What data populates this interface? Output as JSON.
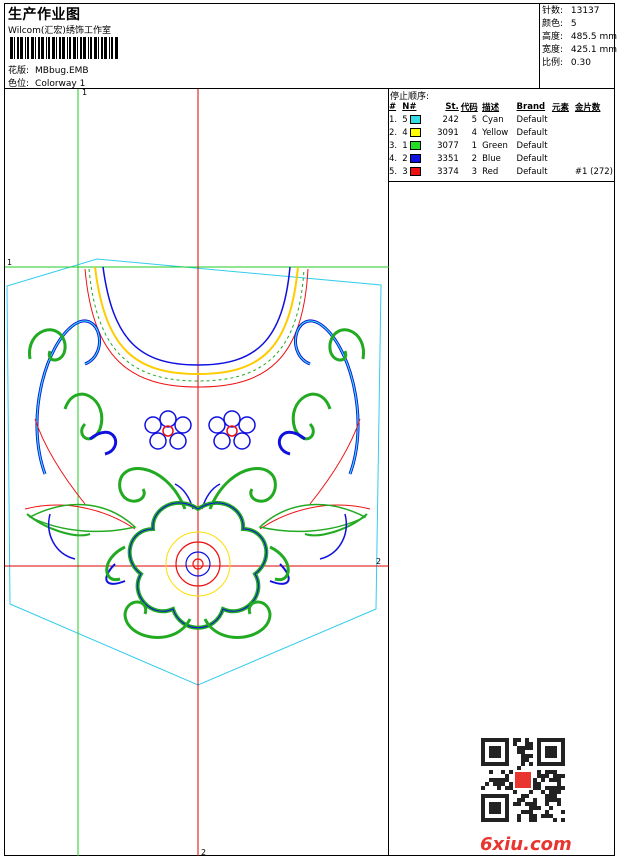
{
  "header": {
    "title": "生产作业图",
    "company": "Wilcom(汇宏)绣饰工作室",
    "design_label": "花版:",
    "design_value": "MBbug.EMB",
    "colorway_label": "色位:",
    "colorway_value": "Colorway 1"
  },
  "stats": [
    {
      "label": "针数:",
      "value": "13137"
    },
    {
      "label": "颜色:",
      "value": "5"
    },
    {
      "label": "高度:",
      "value": "485.5 mm"
    },
    {
      "label": "宽度:",
      "value": "425.1 mm"
    },
    {
      "label": "比例:",
      "value": "0.30"
    }
  ],
  "stop_sequence": {
    "title": "停止顺序:",
    "columns": [
      "#",
      "N#",
      "St.",
      "代码",
      "描述",
      "Brand",
      "元素",
      "金片数"
    ],
    "rows": [
      {
        "idx": "1.",
        "n": "5",
        "color": "#33dde6",
        "st": "242",
        "code": "5",
        "desc": "Cyan",
        "brand": "Default",
        "element": "",
        "sequin": ""
      },
      {
        "idx": "2.",
        "n": "4",
        "color": "#ffff00",
        "st": "3091",
        "code": "4",
        "desc": "Yellow",
        "brand": "Default",
        "element": "",
        "sequin": ""
      },
      {
        "idx": "3.",
        "n": "1",
        "color": "#22dd22",
        "st": "3077",
        "code": "1",
        "desc": "Green",
        "brand": "Default",
        "element": "",
        "sequin": ""
      },
      {
        "idx": "4.",
        "n": "2",
        "color": "#1010e0",
        "st": "3351",
        "code": "2",
        "desc": "Blue",
        "brand": "Default",
        "element": "",
        "sequin": ""
      },
      {
        "idx": "5.",
        "n": "3",
        "color": "#ee1111",
        "st": "3374",
        "code": "3",
        "desc": "Red",
        "brand": "Default",
        "element": "",
        "sequin": "#1 (272)"
      }
    ]
  },
  "canvas": {
    "marker_1_top": "1",
    "marker_1_left": "1",
    "marker_2_right": "2",
    "marker_2_bottom": "2"
  },
  "watermark": "6xiu.com",
  "colors": {
    "guide_green": "#22cc22",
    "guide_red": "#dd0000",
    "outline_cyan": "#33ccee"
  }
}
